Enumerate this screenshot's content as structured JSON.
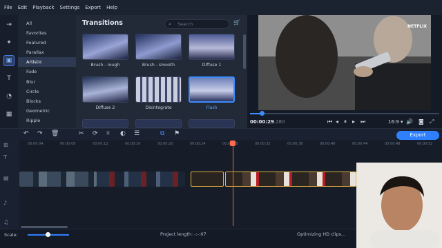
{
  "menu": [
    "File",
    "Edit",
    "Playback",
    "Settings",
    "Export",
    "Help"
  ],
  "categories": [
    "All",
    "Favorites",
    "Featured",
    "Parallax",
    "Artistic",
    "Fade",
    "Blur",
    "Circle",
    "Blocks",
    "Geometric",
    "Ripple"
  ],
  "selected_category": "Artistic",
  "panel": {
    "title": "Transitions",
    "search_placeholder": "Search",
    "tiles": [
      {
        "label": "Brush - rough"
      },
      {
        "label": "Brush - smooth"
      },
      {
        "label": "Diffuse 1"
      },
      {
        "label": "Diffuse 2"
      },
      {
        "label": "Disintegrate"
      },
      {
        "label": "Flash"
      }
    ],
    "selected_tile": "Flash"
  },
  "preview": {
    "watermark": "NETFLIX",
    "time_main": "00:00:29",
    "time_ms": ".280",
    "aspect": "16:9 ▾"
  },
  "toolbar": {
    "export_label": "Export"
  },
  "ruler": [
    "00:00:04",
    "00:00:08",
    "00:00:12",
    "00:00:16",
    "00:00:20",
    "00:00:24",
    "00:00:28",
    "00:00:32",
    "00:00:36",
    "00:00:40",
    "00:00:44",
    "00:00:48",
    "00:00:52"
  ],
  "status": {
    "scale_label": "Scale:",
    "project_length": "Project length: -:-:07",
    "optimizing": "Optimizing HD clips..."
  },
  "colors": {
    "accent": "#2f80ff",
    "playhead": "#ff6a4a",
    "selection": "#e8b341"
  }
}
